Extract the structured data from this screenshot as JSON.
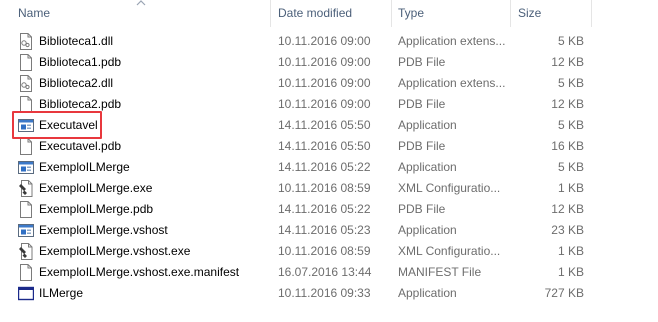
{
  "columns": {
    "name": "Name",
    "date": "Date modified",
    "type": "Type",
    "size": "Size"
  },
  "files": [
    {
      "name": "Biblioteca1.dll",
      "date": "10.11.2016 09:00",
      "type": "Application extens...",
      "size": "5 KB",
      "icon": "dll-file-icon"
    },
    {
      "name": "Biblioteca1.pdb",
      "date": "10.11.2016 09:00",
      "type": "PDB File",
      "size": "12 KB",
      "icon": "blank-file-icon"
    },
    {
      "name": "Biblioteca2.dll",
      "date": "10.11.2016 09:00",
      "type": "Application extens...",
      "size": "5 KB",
      "icon": "dll-file-icon"
    },
    {
      "name": "Biblioteca2.pdb",
      "date": "10.11.2016 09:00",
      "type": "PDB File",
      "size": "12 KB",
      "icon": "blank-file-icon"
    },
    {
      "name": "Executavel",
      "date": "14.11.2016 05:50",
      "type": "Application",
      "size": "5 KB",
      "icon": "application-icon"
    },
    {
      "name": "Executavel.pdb",
      "date": "14.11.2016 05:50",
      "type": "PDB File",
      "size": "16 KB",
      "icon": "blank-file-icon"
    },
    {
      "name": "ExemploILMerge",
      "date": "14.11.2016 05:22",
      "type": "Application",
      "size": "5 KB",
      "icon": "application-icon"
    },
    {
      "name": "ExemploILMerge.exe",
      "date": "10.11.2016 08:59",
      "type": "XML Configuratio...",
      "size": "1 KB",
      "icon": "config-file-icon"
    },
    {
      "name": "ExemploILMerge.pdb",
      "date": "14.11.2016 05:22",
      "type": "PDB File",
      "size": "12 KB",
      "icon": "blank-file-icon"
    },
    {
      "name": "ExemploILMerge.vshost",
      "date": "14.11.2016 05:23",
      "type": "Application",
      "size": "23 KB",
      "icon": "application-icon"
    },
    {
      "name": "ExemploILMerge.vshost.exe",
      "date": "10.11.2016 08:59",
      "type": "XML Configuratio...",
      "size": "1 KB",
      "icon": "config-file-icon"
    },
    {
      "name": "ExemploILMerge.vshost.exe.manifest",
      "date": "16.07.2016 13:44",
      "type": "MANIFEST File",
      "size": "1 KB",
      "icon": "blank-file-icon"
    },
    {
      "name": "ILMerge",
      "date": "10.11.2016 09:33",
      "type": "Application",
      "size": "727 KB",
      "icon": "ilmerge-application-icon"
    }
  ],
  "highlight_color": "#e8383d"
}
